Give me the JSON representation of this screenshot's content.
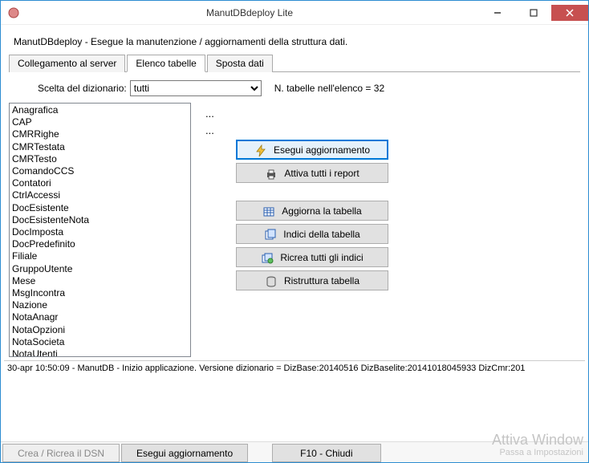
{
  "window": {
    "title": "ManutDBdeploy Lite"
  },
  "description": "ManutDBdeploy - Esegue la manutenzione / aggiornamenti della struttura dati.",
  "tabs": {
    "t0": "Collegamento al server",
    "t1": "Elenco tabelle",
    "t2": "Sposta dati"
  },
  "selector": {
    "label": "Scelta del dizionario:",
    "value": "tutti",
    "count_label": "N. tabelle nell'elenco = 32"
  },
  "tables": [
    "Anagrafica",
    "CAP",
    "CMRRighe",
    "CMRTestata",
    "CMRTesto",
    "ComandoCCS",
    "Contatori",
    "CtrlAccessi",
    "DocEsistente",
    "DocEsistenteNota",
    "DocImposta",
    "DocPredefinito",
    "Filiale",
    "GruppoUtente",
    "Mese",
    "MsgIncontra",
    "Nazione",
    "NotaAnagr",
    "NotaOpzioni",
    "NotaSocieta",
    "NotaUtenti"
  ],
  "dots1": "...",
  "dots2": "...",
  "buttons": {
    "run_update": "Esegui aggiornamento",
    "enable_reports": "Attiva tutti i report",
    "refresh_table": "Aggiorna la tabella",
    "table_indexes": "Indici della tabella",
    "recreate_indexes": "Ricrea tutti gli indici",
    "restructure": "Ristruttura tabella"
  },
  "log": "30-apr 10:50:09 - ManutDB - Inizio applicazione.   Versione dizionario = DizBase:20140516 DizBaselite:20141018045933 DizCmr:201",
  "bottom": {
    "dsn": "Crea / Ricrea il DSN",
    "run": "Esegui aggiornamento",
    "close": "F10 - Chiudi"
  },
  "watermark": {
    "line1": "Attiva Window",
    "line2": "Passa a Impostazioni"
  }
}
